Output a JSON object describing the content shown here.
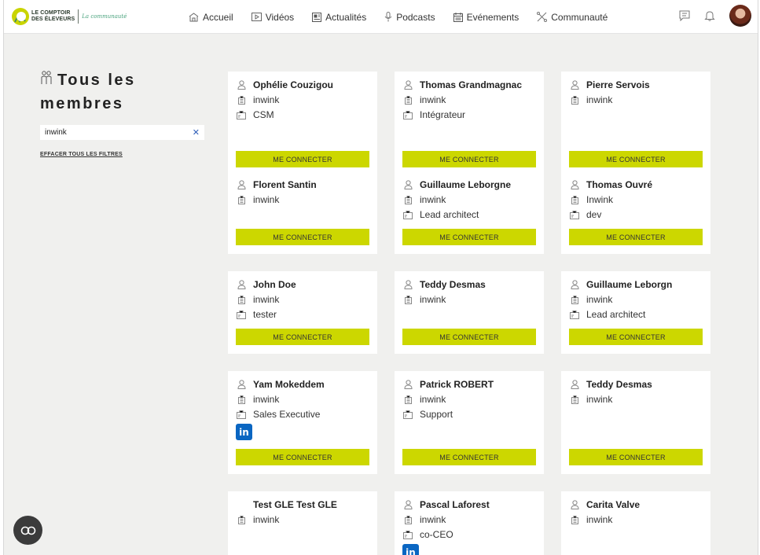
{
  "brand": {
    "line1": "LE COMPTOIR",
    "line2": "DES ÉLEVEURS",
    "tagline": "La communauté",
    "accent": "#ccd700"
  },
  "nav": [
    {
      "label": "Accueil",
      "icon": "home-icon"
    },
    {
      "label": "Vidéos",
      "icon": "video-icon"
    },
    {
      "label": "Actualités",
      "icon": "news-icon"
    },
    {
      "label": "Podcasts",
      "icon": "microphone-icon"
    },
    {
      "label": "Evénements",
      "icon": "calendar-icon"
    },
    {
      "label": "Communauté",
      "icon": "community-icon"
    }
  ],
  "sidebar": {
    "title_line1": "Tous les",
    "title_line2": "membres",
    "filter_value": "inwink",
    "clear_label": "EFFACER TOUS LES FILTRES"
  },
  "connect_label": "ME CONNECTER",
  "members": [
    {
      "name": "Ophélie Couzigou",
      "company": "inwink",
      "role": "CSM",
      "linkedin": false
    },
    {
      "name": "Thomas Grandmagnac",
      "company": "inwink",
      "role": "Intégrateur",
      "linkedin": false
    },
    {
      "name": "Pierre Servois",
      "company": "inwink",
      "role": "",
      "linkedin": false
    },
    {
      "name": "Florent Santin",
      "company": "inwink",
      "role": "",
      "linkedin": false
    },
    {
      "name": "Guillaume Leborgne",
      "company": "inwink",
      "role": "Lead architect",
      "linkedin": false
    },
    {
      "name": "Thomas Ouvré",
      "company": "Inwink",
      "role": "dev",
      "linkedin": false
    },
    {
      "name": "John Doe",
      "company": "inwink",
      "role": "tester",
      "linkedin": false
    },
    {
      "name": "Teddy Desmas",
      "company": "inwink",
      "role": "",
      "linkedin": false
    },
    {
      "name": "Guillaume Leborgn",
      "company": "inwink",
      "role": "Lead architect",
      "linkedin": false
    },
    {
      "name": "Yam Mokeddem",
      "company": "inwink",
      "role": "Sales Executive",
      "linkedin": true
    },
    {
      "name": "Patrick ROBERT",
      "company": "inwink",
      "role": "Support",
      "linkedin": false
    },
    {
      "name": "Teddy Desmas",
      "company": "inwink",
      "role": "",
      "linkedin": false
    },
    {
      "name": "Test GLE Test GLE",
      "company": "inwink",
      "role": "",
      "linkedin": false,
      "no_icon": true
    },
    {
      "name": "Pascal Laforest",
      "company": "inwink",
      "role": "co-CEO",
      "linkedin": true
    },
    {
      "name": "Carita Valve",
      "company": "inwink",
      "role": "",
      "linkedin": false
    }
  ],
  "linkedin_label": "in"
}
